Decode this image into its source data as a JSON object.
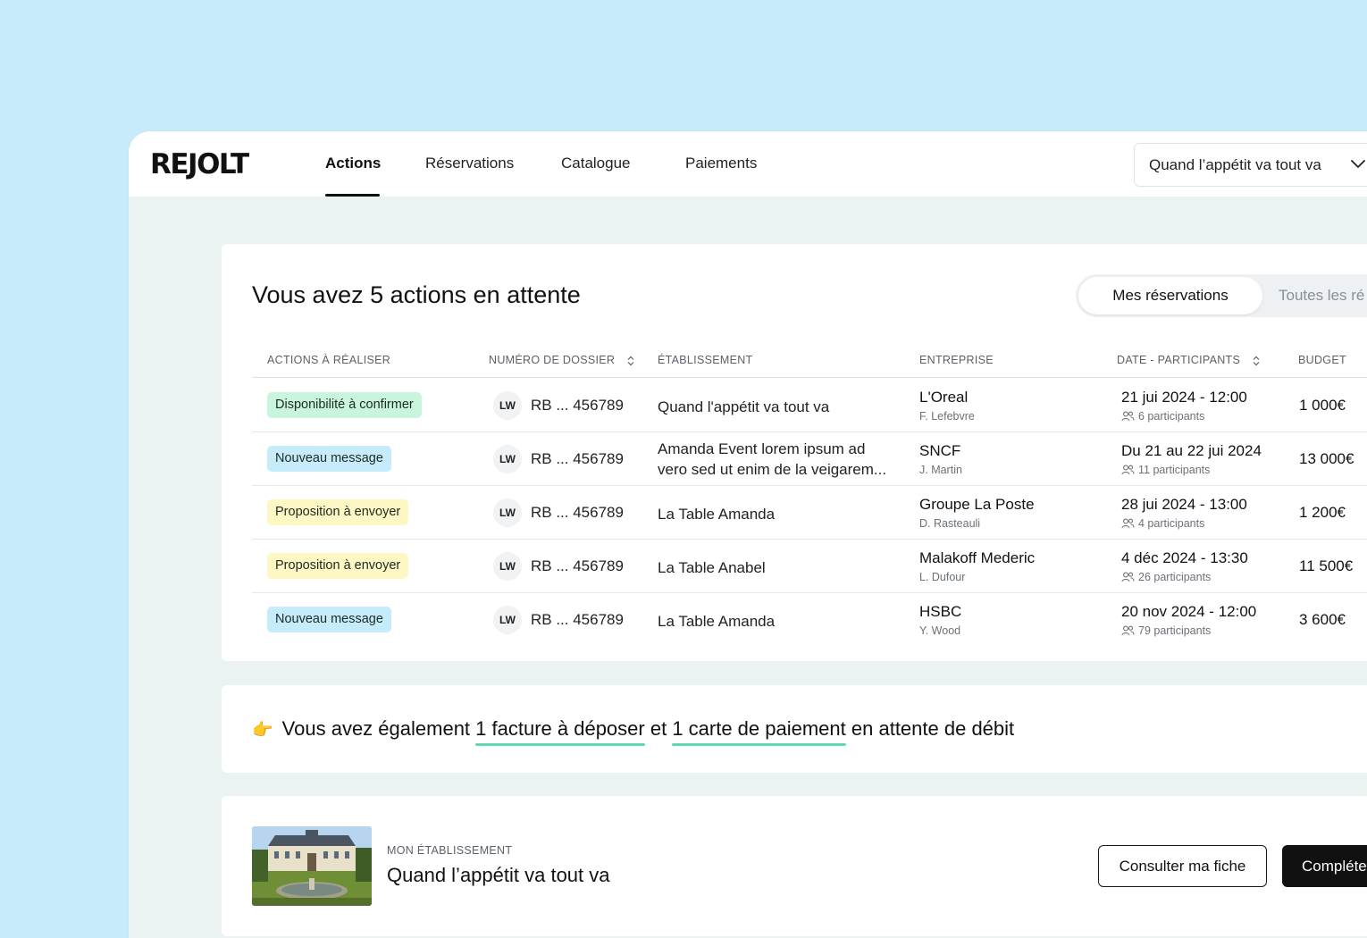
{
  "header": {
    "logo": "REJOLT",
    "nav": [
      "Actions",
      "Réservations",
      "Catalogue",
      "Paiements"
    ],
    "venue_selector": "Quand l’appétit va tout va"
  },
  "actions": {
    "title": "Vous avez 5 actions en attente",
    "toggle": {
      "active": "Mes réservations",
      "inactive": "Toutes les ré"
    },
    "columns": {
      "action": "ACTIONS À RÉALISER",
      "dossier": "NUMÉRO DE DOSSIER",
      "etablissement": "ÉTABLISSEMENT",
      "entreprise": "ENTREPRISE",
      "date": "DATE - PARTICIPANTS",
      "budget": "BUDGET"
    },
    "rows": [
      {
        "action": "Disponibilité à confirmer",
        "badge_color": "#c9f5dd",
        "initials": "LW",
        "dossier": "RB ... 456789",
        "etablissement": "Quand l'appétit va tout va",
        "entreprise": "L'Oreal",
        "contact": "F. Lefebvre",
        "date": "21 jui 2024 - 12:00",
        "participants": "6 participants",
        "budget": "1 000€"
      },
      {
        "action": "Nouveau message",
        "badge_color": "#c6ecfb",
        "initials": "LW",
        "dossier": "RB ... 456789",
        "etablissement": "Amanda Event lorem ipsum ad vero sed ut enim de la veigarem...",
        "entreprise": "SNCF",
        "contact": "J. Martin",
        "date": "Du 21 au 22 jui 2024",
        "participants": "11 participants",
        "budget": "13 000€"
      },
      {
        "action": "Proposition à envoyer",
        "badge_color": "#fdf7c4",
        "initials": "LW",
        "dossier": "RB ... 456789",
        "etablissement": "La Table Amanda",
        "entreprise": "Groupe La Poste",
        "contact": "D. Rasteauli",
        "date": "28 jui 2024 - 13:00",
        "participants": "4 participants",
        "budget": "1 200€"
      },
      {
        "action": "Proposition à envoyer",
        "badge_color": "#fdf7c4",
        "initials": "LW",
        "dossier": "RB ... 456789",
        "etablissement": "La Table Anabel",
        "entreprise": "Malakoff Mederic",
        "contact": "L. Dufour",
        "date": "4 déc 2024 - 13:30",
        "participants": "26 participants",
        "budget": "11 500€"
      },
      {
        "action": "Nouveau message",
        "badge_color": "#c6ecfb",
        "initials": "LW",
        "dossier": "RB ... 456789",
        "etablissement": "La Table Amanda",
        "entreprise": "HSBC",
        "contact": "Y. Wood",
        "date": "20 nov 2024 - 12:00",
        "participants": "79 participants",
        "budget": "3 600€"
      }
    ]
  },
  "invoice": {
    "emoji": "👉",
    "prefix": "Vous avez également ",
    "link1": "1 facture à déposer",
    "middle": " et ",
    "link2": "1 carte de paiement",
    "suffix": " en attente de débit",
    "underline_color": "#5ed9b0"
  },
  "venue": {
    "kicker": "MON ÉTABLISSEMENT",
    "name": "Quand l’appétit va tout va",
    "consult_button": "Consulter ma fiche",
    "complete_button": "Compléter"
  }
}
